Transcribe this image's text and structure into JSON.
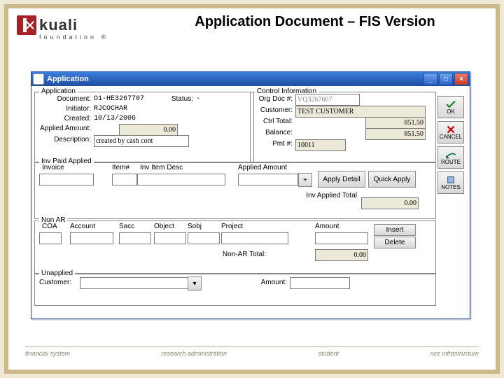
{
  "slide": {
    "title": "Application Document – FIS Version"
  },
  "logo": {
    "brand": "kuali",
    "sub": "foundation ®"
  },
  "window": {
    "title": "Application"
  },
  "app": {
    "legend": "Application",
    "document_lbl": "Document:",
    "document": "O1-HE3267707",
    "status_lbl": "Status:",
    "status": "-",
    "initiator_lbl": "Initiator:",
    "initiator": "RJCOCHAR",
    "created_lbl": "Created:",
    "created": "10/13/2006",
    "applied_amount_lbl": "Applied Amount:",
    "applied_amount": "0.00",
    "description_lbl": "Description:",
    "description": "created by cash cont"
  },
  "ctrl": {
    "legend": "Control Information",
    "org_doc_lbl": "Org Doc #:",
    "org_doc": "VQ3267607",
    "customer_lbl": "Customer:",
    "customer": "TEST CUSTOMER",
    "ctrl_total_lbl": "Ctrl Total:",
    "ctrl_total": "851.50",
    "balance_lbl": "Balance:",
    "balance": "851.50",
    "pmt_lbl": "Pmt #:",
    "pmt": "10011"
  },
  "invpaid": {
    "legend": "Inv Paid Applied",
    "invoice_lbl": "Invoice",
    "item_lbl": "Item#",
    "desc_lbl": "Inv Item Desc",
    "applied_lbl": "Applied Amount",
    "plus": "+",
    "apply_detail": "Apply Detail",
    "quick_apply": "Quick Apply",
    "total_lbl": "Inv Applied Total",
    "total": "0.00"
  },
  "nonar": {
    "legend": "Non AR",
    "coa_lbl": "COA",
    "acct_lbl": "Account",
    "sacc_lbl": "Sacc",
    "obj_lbl": "Object",
    "sobj_lbl": "Sobj",
    "proj_lbl": "Project",
    "amt_lbl": "Amount",
    "insert": "Insert",
    "delete": "Delete",
    "total_lbl": "Non-AR Total:",
    "total": "0.00"
  },
  "unapplied": {
    "legend": "Unapplied",
    "customer_lbl": "Customer:",
    "amount_lbl": "Amount:"
  },
  "sidebar": {
    "ok": "OK",
    "cancel": "CANCEL",
    "route": "ROUTE",
    "notes": "NOTES"
  },
  "footer": {
    "a": "financial system",
    "b": "research administration",
    "c": "student",
    "d": "rice infrastructure"
  }
}
